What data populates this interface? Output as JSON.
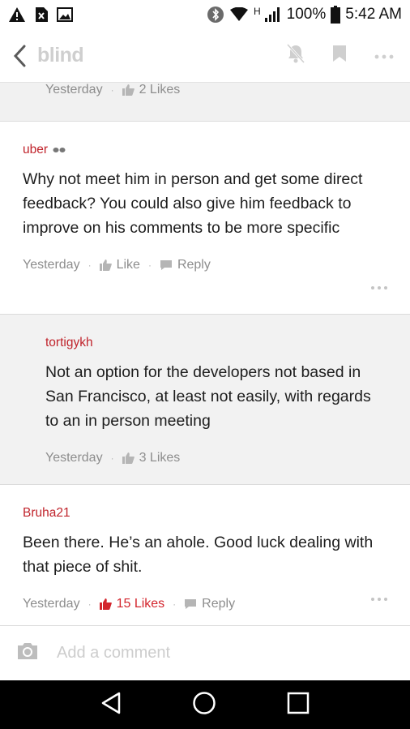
{
  "status_bar": {
    "battery": "100%",
    "time": "5:42 AM",
    "network_label": "H"
  },
  "app": {
    "logo": "blind"
  },
  "top_comment_tail": {
    "time": "Yesterday",
    "likes": "2 Likes"
  },
  "comments": [
    {
      "author": "uber",
      "text": "Why not meet him in person and get some direct feedback? You could also give him feedback to improve on his comments to be more specific",
      "time": "Yesterday",
      "like_label": "Like",
      "reply_label": "Reply"
    },
    {
      "author": "tortigykh",
      "text": "Not an option for the developers not based in San Francisco, at least not easily, with regards to an in person meeting",
      "time": "Yesterday",
      "like_label": "3 Likes"
    },
    {
      "author": "Bruha21",
      "text": "Been there. He’s an ahole. Good luck dealing with that piece of shit.",
      "time": "Yesterday",
      "like_label": "15 Likes",
      "reply_label": "Reply"
    }
  ],
  "input": {
    "placeholder": "Add a comment"
  },
  "colors": {
    "accent": "#c0232b",
    "liked": "#d3252d",
    "muted": "#8d8d8d"
  }
}
